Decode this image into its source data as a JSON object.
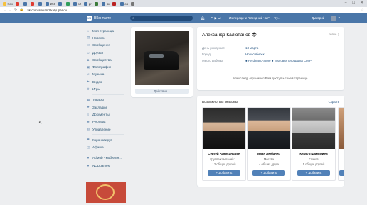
{
  "browser": {
    "tabs": [
      {
        "label": "Кон",
        "color": "#f6c13e"
      },
      {
        "label": "",
        "color": "#e03c31"
      },
      {
        "label": "",
        "color": "#4a76a8"
      },
      {
        "label": "",
        "color": "#e03c31"
      },
      {
        "label": "",
        "color": "#4a76a8"
      },
      {
        "label": "250",
        "color": "#4a76a8"
      },
      {
        "label": "",
        "color": "#4a76a8"
      },
      {
        "label": "",
        "color": "#2f9d5b"
      },
      {
        "label": "з2",
        "color": "#4a76a8"
      },
      {
        "label": "рг",
        "color": "#4a76a8"
      },
      {
        "label": "",
        "color": "#3b7b3b"
      },
      {
        "label": "вк",
        "color": "#4a76a8"
      },
      {
        "label": "",
        "color": "#b22"
      },
      {
        "label": "оо",
        "color": "#4a76a8"
      },
      {
        "label": "",
        "color": "#777"
      }
    ],
    "url": "vk.com/alexandrkalyupanov",
    "window_controls": "– ☐ ✕"
  },
  "header": {
    "logo": "VK",
    "brand": "ВКонтакте",
    "search_placeholder": "",
    "track": "Из передачи \"Звездный час\" — Чу...",
    "user_name": "Дмитрий"
  },
  "sidebar": {
    "group1": [
      {
        "label": "Моя страница",
        "icon": "home-icon",
        "glyph": "⌂"
      },
      {
        "label": "Новости",
        "icon": "news-icon",
        "glyph": "▤"
      },
      {
        "label": "Сообщения",
        "icon": "message-icon",
        "glyph": "✉"
      },
      {
        "label": "Друзья",
        "icon": "friends-icon",
        "glyph": "☺"
      },
      {
        "label": "Сообщества",
        "icon": "groups-icon",
        "glyph": "☻"
      },
      {
        "label": "Фотографии",
        "icon": "photo-icon",
        "glyph": "▣"
      },
      {
        "label": "Музыка",
        "icon": "music-icon",
        "glyph": "♫"
      },
      {
        "label": "Видео",
        "icon": "video-icon",
        "glyph": "▶"
      },
      {
        "label": "Игры",
        "icon": "games-icon",
        "glyph": "✚"
      }
    ],
    "group2": [
      {
        "label": "Товары",
        "icon": "goods-icon",
        "glyph": "▦"
      },
      {
        "label": "Закладки",
        "icon": "bookmark-icon",
        "glyph": "★"
      },
      {
        "label": "Документы",
        "icon": "document-icon",
        "glyph": "▯"
      },
      {
        "label": "Реклама",
        "icon": "ads-icon",
        "glyph": "◈"
      },
      {
        "label": "Управление",
        "icon": "manage-icon",
        "glyph": "▥"
      }
    ],
    "group3": [
      {
        "label": "Коронавирус",
        "icon": "virus-icon",
        "glyph": "✺"
      },
      {
        "label": "Афиша",
        "icon": "poster-icon",
        "glyph": "◫"
      }
    ],
    "group4": [
      {
        "label": "AdMob - мобильн...",
        "icon": "admob-icon",
        "glyph": "●"
      },
      {
        "label": "NODgames",
        "icon": "nodgames-icon",
        "glyph": "●"
      }
    ]
  },
  "profile": {
    "name": "Александр Калюпанов 😎",
    "status": "online ▯",
    "actions_label": "Действия ⌄",
    "fields": [
      {
        "label": "День рождения:",
        "value": "13 марта"
      },
      {
        "label": "Город:",
        "value": "Новосибирск"
      },
      {
        "label": "Место работы:",
        "value": "● Ferdinand-Store  ● Торговая площадка CIMP"
      }
    ],
    "restricted_text": "Александр ограничил Вам доступ к своей странице."
  },
  "friends": {
    "title": "Возможно, Вы знакомы",
    "hide_label": "Скрыть",
    "add_label": "+ Добавить",
    "items": [
      {
        "name": "Сергей Александрин",
        "subtitle": "Группа компаний \"...",
        "mutual": "12 общих друзей"
      },
      {
        "name": "Иван Любанец",
        "subtitle": "Москва",
        "mutual": "4 общих друга"
      },
      {
        "name": "Кирилл Дмитриев",
        "subtitle": "Глазов",
        "mutual": "5 общих друзей"
      }
    ]
  }
}
